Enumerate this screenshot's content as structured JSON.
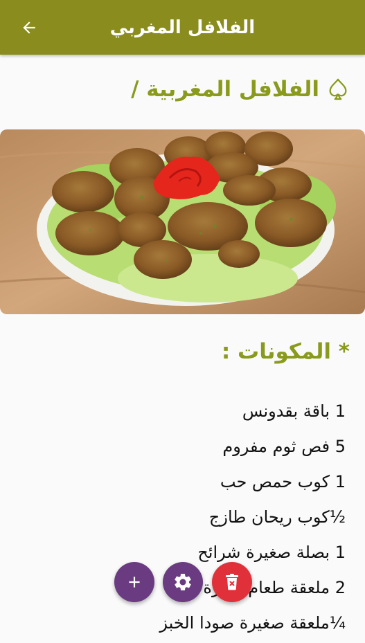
{
  "appbar": {
    "title": "الفلافل المغربي",
    "back_icon": "arrow-left-icon",
    "color": "#8a8d1e"
  },
  "recipe": {
    "heading": "الفلافل المغربية /",
    "heading_icon": "spade-icon",
    "accent_color": "#8a9a1d",
    "image": "falafel-plate-photo",
    "ingredients_title": "* المكونات :",
    "ingredients": [
      "1 باقة بقدونس",
      "5 فص ثوم مفروم",
      "1 كوب حمص حب",
      "½كوب ريحان طازج",
      "1 بصلة صغيرة شرائح",
      "2 ملعقة طعام كزبرة جافة",
      "¼ملعقة صغيرة صودا الخبز"
    ]
  },
  "fabs": {
    "add_icon": "plus-icon",
    "settings_icon": "gear-icon",
    "delete_icon": "trash-icon",
    "primary_color": "#6b3b82",
    "delete_color": "#e0313a"
  }
}
